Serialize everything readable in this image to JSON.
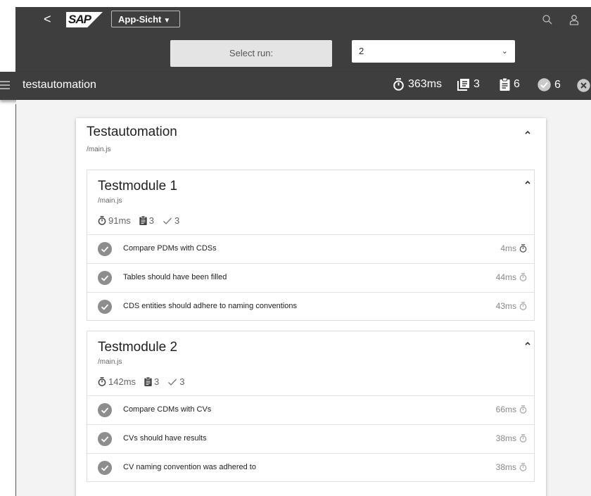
{
  "shell": {
    "back_label": "<",
    "logo_text": "SAP",
    "app_view_label": "App-Sicht",
    "search_icon": "search-icon",
    "user_icon": "user-icon"
  },
  "run": {
    "button_label": "Select run:",
    "selected_value": "2"
  },
  "header": {
    "title": "testautomation",
    "duration": "363ms",
    "modules_count": "3",
    "tests_count": "6",
    "passed_count": "6"
  },
  "report": {
    "title": "Testautomation",
    "file": "/main.js",
    "modules": [
      {
        "title": "Testmodule 1",
        "file": "/main.js",
        "duration": "91ms",
        "tests": "3",
        "passed": "3",
        "cases": [
          {
            "name": "Compare PDMs with CDSs",
            "duration": "4ms"
          },
          {
            "name": "Tables should have been filled",
            "duration": "44ms"
          },
          {
            "name": "CDS entities should adhere to naming conventions",
            "duration": "43ms"
          }
        ]
      },
      {
        "title": "Testmodule 2",
        "file": "/main.js",
        "duration": "142ms",
        "tests": "3",
        "passed": "3",
        "cases": [
          {
            "name": "Compare CDMs with CVs",
            "duration": "66ms"
          },
          {
            "name": "CVs should have results",
            "duration": "38ms"
          },
          {
            "name": "CV naming convention was adhered to",
            "duration": "38ms"
          }
        ]
      }
    ]
  },
  "colors": {
    "bar_background": "#3e3e3e",
    "content_background": "#f3f3f3",
    "status_passed": "#8d8d8d"
  }
}
